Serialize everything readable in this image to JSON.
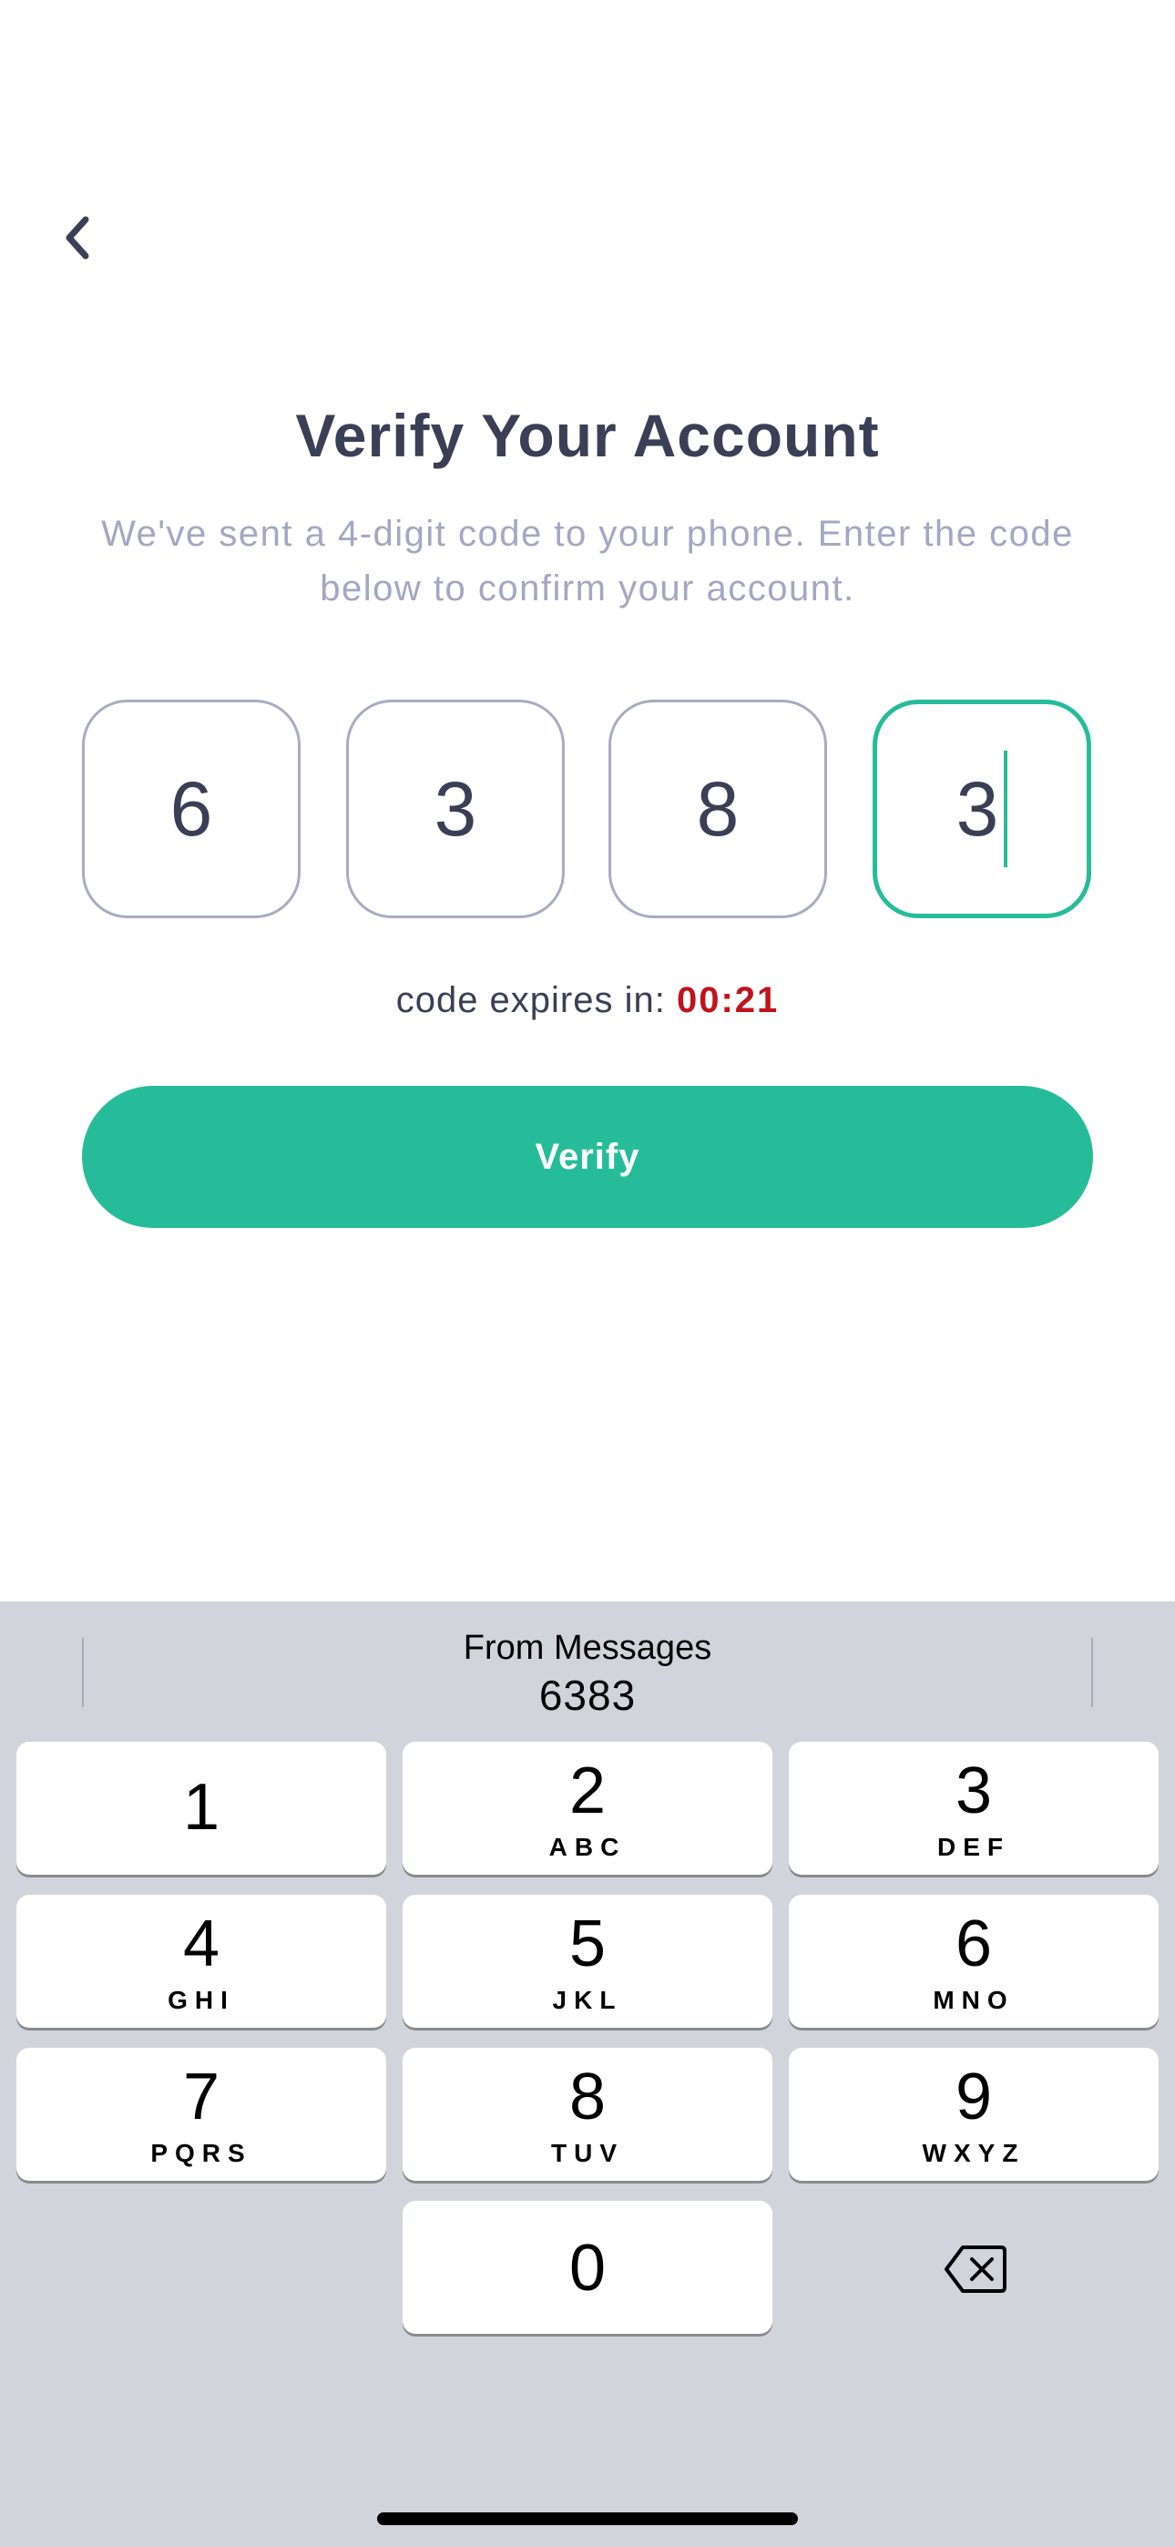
{
  "header": {
    "back_icon": "chevron-left-icon"
  },
  "verify": {
    "title": "Verify Your Account",
    "subtitle": "We've sent a 4-digit code to your phone. Enter the code below to confirm your account.",
    "code_digits": [
      "6",
      "3",
      "8",
      "3"
    ],
    "active_index": 3,
    "expiry_label": "code expires in:",
    "expiry_time": "00:21",
    "button_label": "Verify"
  },
  "colors": {
    "accent": "#26bc9a",
    "timer": "#c0141c",
    "text": "#3b3f55",
    "muted": "#a3a7c2",
    "box_border": "#a9abc3",
    "keyboard_bg": "#d1d4db"
  },
  "keyboard": {
    "suggestion": {
      "label": "From Messages",
      "code": "6383"
    },
    "keys": [
      {
        "digit": "1",
        "letters": ""
      },
      {
        "digit": "2",
        "letters": "ABC"
      },
      {
        "digit": "3",
        "letters": "DEF"
      },
      {
        "digit": "4",
        "letters": "GHI"
      },
      {
        "digit": "5",
        "letters": "JKL"
      },
      {
        "digit": "6",
        "letters": "MNO"
      },
      {
        "digit": "7",
        "letters": "PQRS"
      },
      {
        "digit": "8",
        "letters": "TUV"
      },
      {
        "digit": "9",
        "letters": "WXYZ"
      },
      {
        "digit": "0",
        "letters": ""
      }
    ],
    "delete_icon": "backspace-icon"
  }
}
